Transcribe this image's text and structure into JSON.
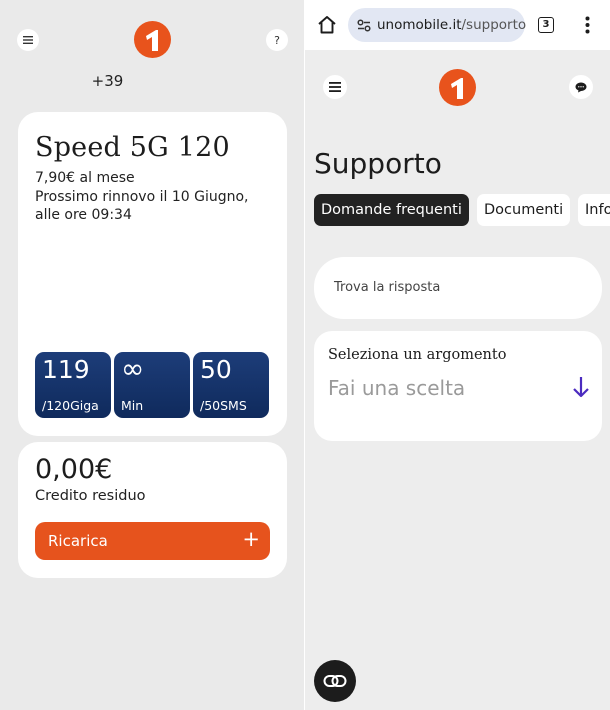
{
  "left_app": {
    "phone_prefix": "+39",
    "plan": {
      "name": "Speed 5G 120",
      "price": "7,90€ al mese",
      "renewal": "Prossimo rinnovo il 10 Giugno, alle ore 09:34",
      "counters": [
        {
          "value": "119",
          "unit": "/120Giga"
        },
        {
          "value": "∞",
          "unit": "Min"
        },
        {
          "value": "50",
          "unit": "/50SMS"
        }
      ]
    },
    "credit": {
      "amount": "0,00€",
      "label": "Credito residuo",
      "topup_label": "Ricarica",
      "topup_icon": "+"
    },
    "help_icon": "?",
    "logo_digit": "1"
  },
  "browser": {
    "url_domain": "unomobile.it",
    "url_path": "/supporto",
    "tab_count": "3"
  },
  "support_page": {
    "title": "Supporto",
    "tabs": [
      {
        "label": "Domande frequenti",
        "active": true
      },
      {
        "label": "Documenti",
        "active": false
      },
      {
        "label": "Info",
        "active": false
      }
    ],
    "search_placeholder": "Trova la risposta",
    "topic_label": "Seleziona un argomento",
    "topic_value": "Fai una scelta"
  },
  "colors": {
    "brand_orange": "#e8531c",
    "counter_blue": "#14326b",
    "arrow_purple": "#4b2bbf"
  }
}
